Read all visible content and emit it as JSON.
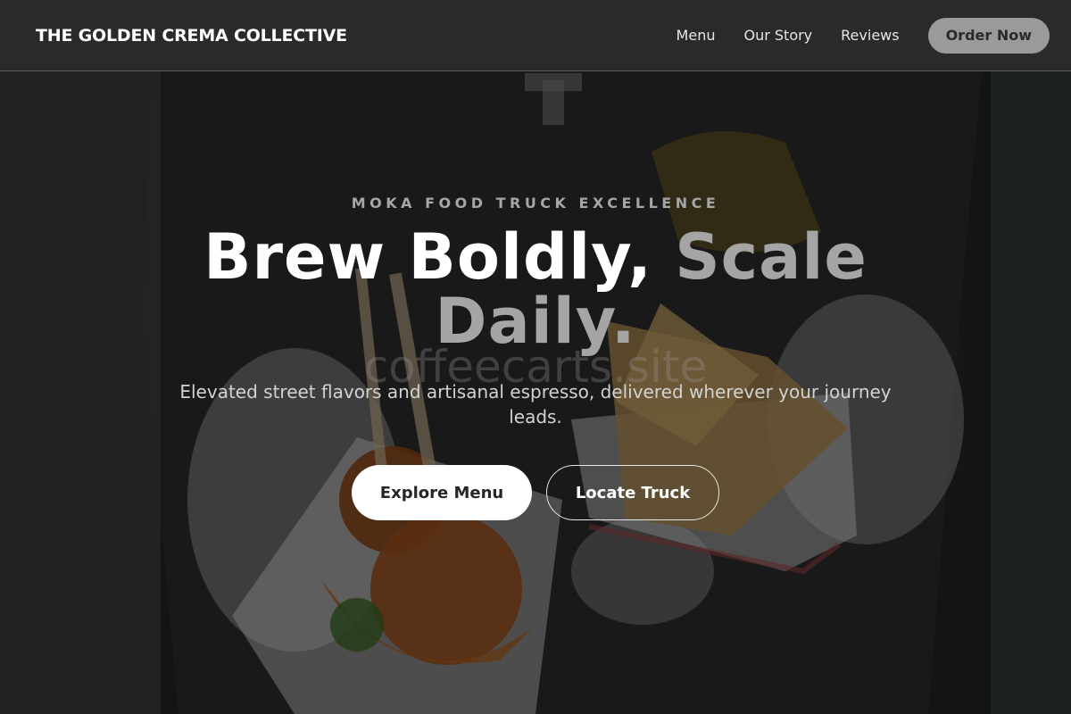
{
  "header": {
    "brand": "THE GOLDEN CREMA COLLECTIVE",
    "nav": [
      {
        "label": "Menu"
      },
      {
        "label": "Our Story"
      },
      {
        "label": "Reviews"
      }
    ],
    "cta_label": "Order Now"
  },
  "hero": {
    "eyebrow": "MOKA FOOD TRUCK EXCELLENCE",
    "headline_main": "Brew Boldly, ",
    "headline_accent": "Scale Daily.",
    "watermark": "coffeecarts.site",
    "subtitle": "Elevated street flavors and artisanal espresso, delivered wherever your journey leads.",
    "primary_button": "Explore Menu",
    "secondary_button": "Locate Truck"
  },
  "colors": {
    "header_bg": "#2c2c2c",
    "accent_gray": "#a5a5a5",
    "order_button_bg": "#9a9a9a",
    "primary_button_bg": "#ffffff",
    "text_white": "#ffffff"
  }
}
